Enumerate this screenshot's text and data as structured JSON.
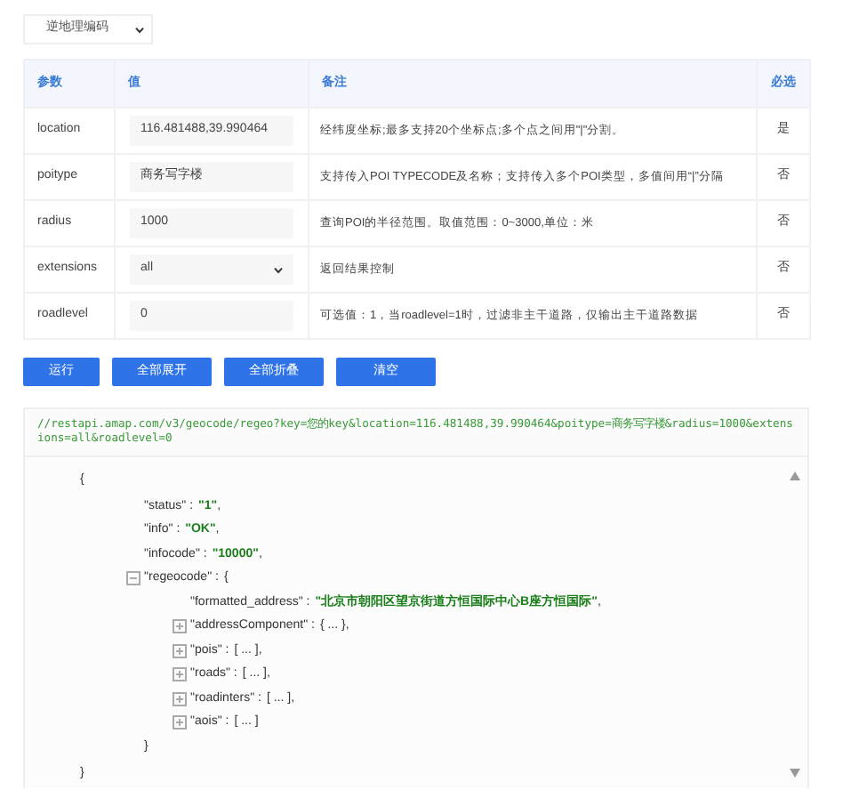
{
  "api_select": {
    "value": "逆地理编码"
  },
  "table": {
    "columns": [
      "参数",
      "值",
      "备注",
      "必选"
    ],
    "rows": [
      {
        "name": "location",
        "kind": "input",
        "value": "116.481488,39.990464",
        "note": "经纬度坐标;最多支持20个坐标点;多个点之间用\"|\"分割。",
        "required": "是"
      },
      {
        "name": "poitype",
        "kind": "input",
        "value": "商务写字楼",
        "note": "支持传入POI TYPECODE及名称；支持传入多个POI类型，多值间用“|”分隔",
        "required": "否"
      },
      {
        "name": "radius",
        "kind": "input",
        "value": "1000",
        "note": "查询POI的半径范围。取值范围：0~3000,单位：米",
        "required": "否"
      },
      {
        "name": "extensions",
        "kind": "select",
        "value": "all",
        "note": "返回结果控制",
        "required": "否"
      },
      {
        "name": "roadlevel",
        "kind": "input",
        "value": "0",
        "note": "可选值：1，当roadlevel=1时，过滤非主干道路，仅输出主干道路数据",
        "required": "否"
      }
    ]
  },
  "buttons": [
    "运行",
    "全部展开",
    "全部折叠",
    "清空"
  ],
  "request_url": "//restapi.amap.com/v3/geocode/regeo?key=您的key&location=116.481488,39.990464&poitype=商务写字楼&radius=1000&extensions=all&roadlevel=0",
  "response": {
    "open": "{",
    "close": "}",
    "children": [
      {
        "key": "\"status\" :",
        "kind": "string",
        "value": "\"1\"",
        "tail": ","
      },
      {
        "key": "\"info\" :",
        "kind": "string",
        "value": "\"OK\"",
        "tail": ","
      },
      {
        "key": "\"infocode\" :",
        "kind": "string",
        "value": "\"10000\"",
        "tail": ","
      },
      {
        "key": "\"regeocode\" :",
        "kind": "object",
        "expanded": true,
        "value": "{",
        "close": "}",
        "children": [
          {
            "key": "\"formatted_address\" :",
            "kind": "string",
            "value": "\"北京市朝阳区望京街道方恒国际中心B座方恒国际\"",
            "tail": ","
          },
          {
            "key": "\"addressComponent\" :",
            "kind": "object",
            "expanded": false,
            "value": "{ ... }",
            "tail": ","
          },
          {
            "key": "\"pois\" :",
            "kind": "array",
            "expanded": false,
            "value": "[ ... ]",
            "tail": ","
          },
          {
            "key": "\"roads\" :",
            "kind": "array",
            "expanded": false,
            "value": "[ ... ]",
            "tail": ","
          },
          {
            "key": "\"roadinters\" :",
            "kind": "array",
            "expanded": false,
            "value": "[ ... ]",
            "tail": ","
          },
          {
            "key": "\"aois\" :",
            "kind": "array",
            "expanded": false,
            "value": "[ ... ]"
          }
        ]
      }
    ]
  }
}
